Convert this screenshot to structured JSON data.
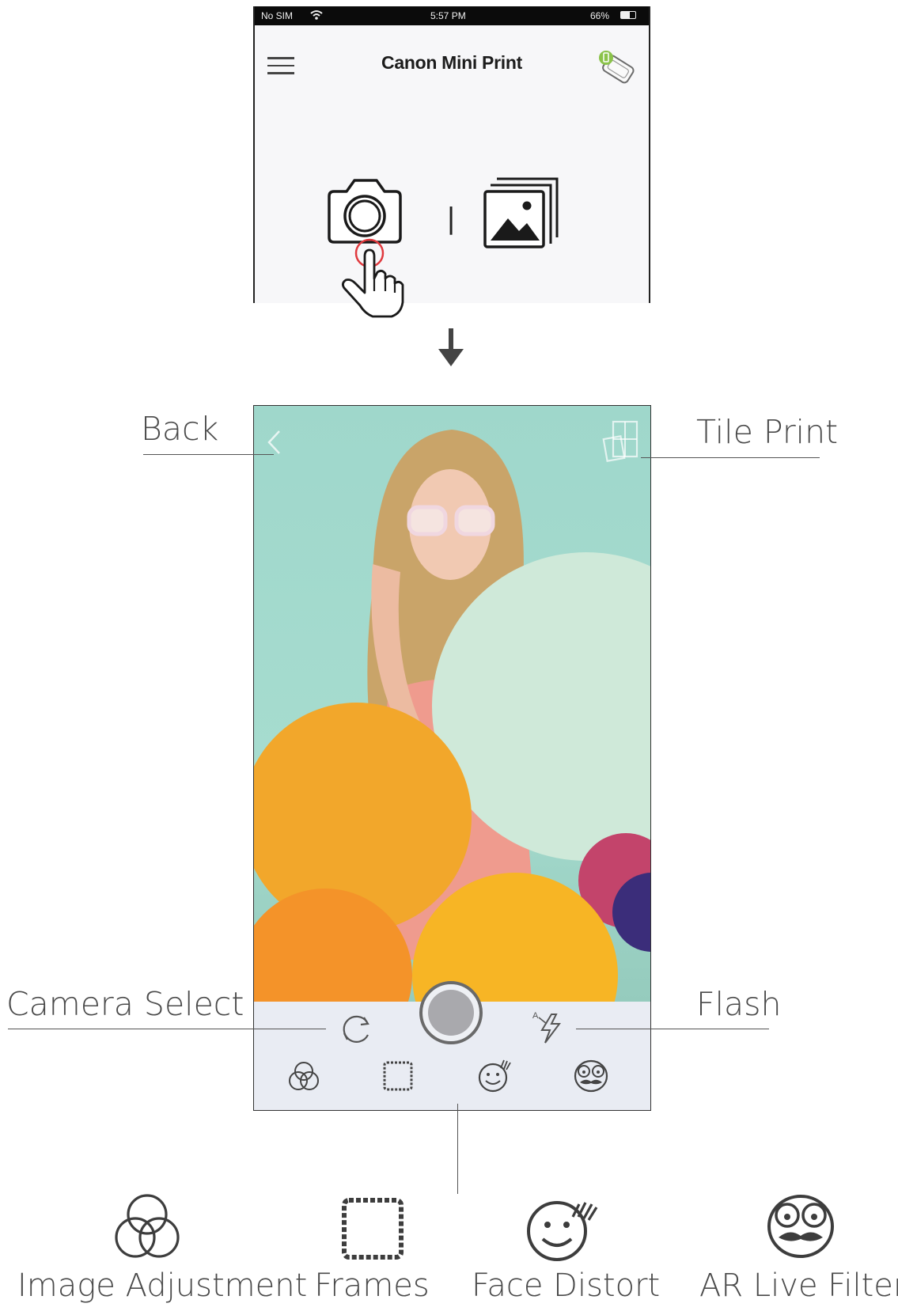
{
  "status_bar": {
    "carrier": "No SIM",
    "time": "5:57 PM",
    "battery": "66%"
  },
  "app_header": {
    "title": "Canon Mini Print"
  },
  "home": {
    "camera_icon": "camera-icon",
    "gallery_icon": "gallery-icon",
    "divider": "|"
  },
  "callouts": {
    "back": "Back",
    "tile_print": "Tile Print",
    "camera_select": "Camera Select",
    "flash": "Flash"
  },
  "flash_indicator": "A",
  "tools": [
    {
      "label": "Image Adjustment",
      "icon": "image-adjustment-icon"
    },
    {
      "label": "Frames",
      "icon": "frames-icon"
    },
    {
      "label": "Face Distort",
      "icon": "face-distort-icon"
    },
    {
      "label": "AR Live Filter",
      "icon": "ar-live-filter-icon"
    }
  ],
  "colors": {
    "accent_red": "#e0393e",
    "battery_green": "#8bc34a",
    "photo_bg": "#a6dccf",
    "controls_bg": "#e9ecf3"
  }
}
